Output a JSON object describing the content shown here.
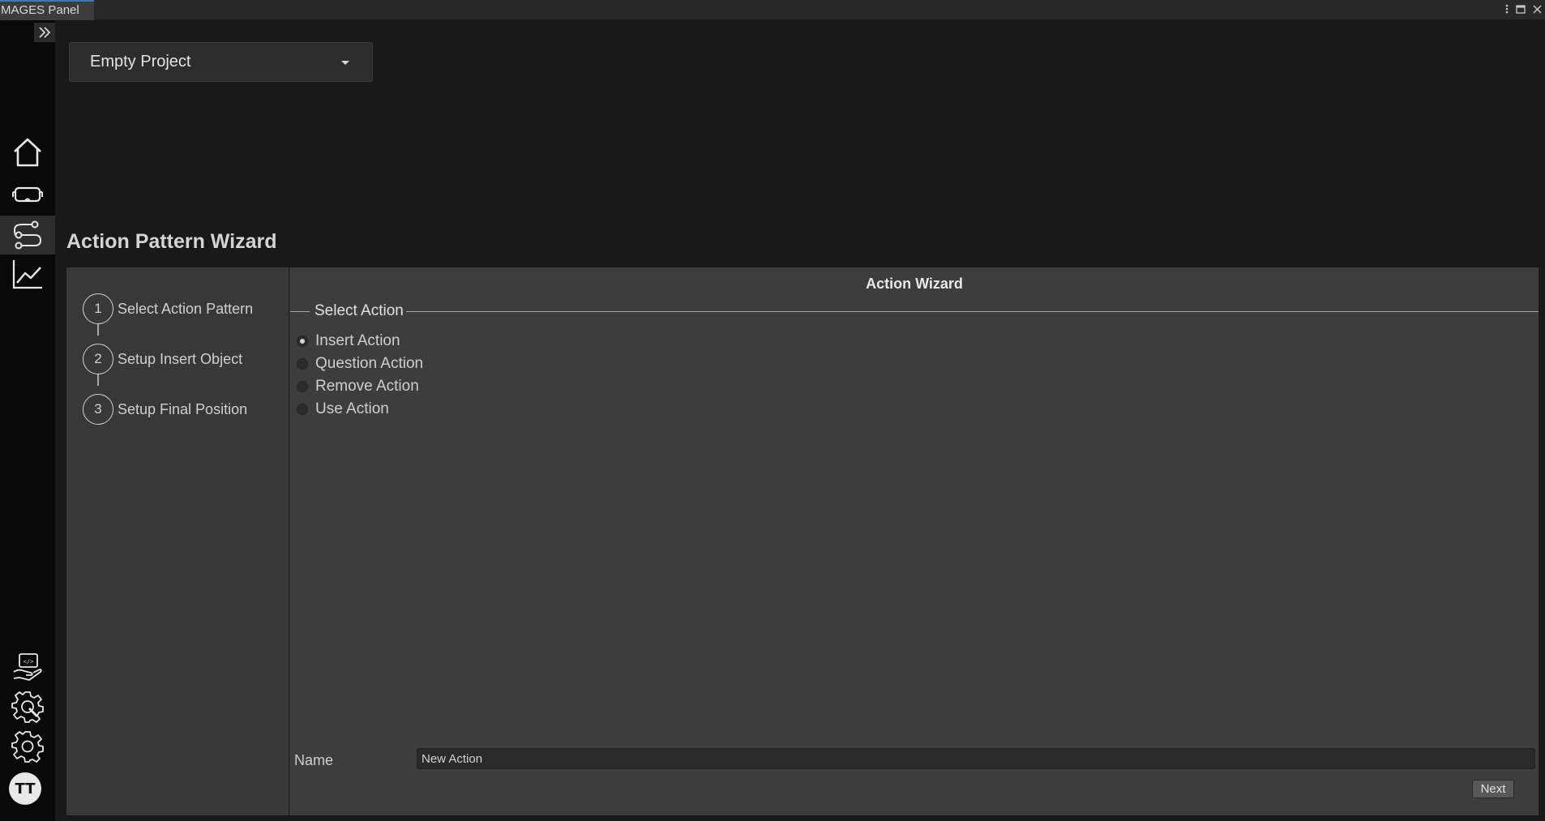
{
  "window": {
    "tab_title": "MAGES Panel",
    "tab_actions": [
      "more-vertical-icon",
      "maximize-icon",
      "close-icon"
    ]
  },
  "sidebar": {
    "expand_icon": "double-chevron-right-icon",
    "items": [
      {
        "name": "home",
        "icon": "home-icon",
        "active": false
      },
      {
        "name": "vr-headset",
        "icon": "vr-headset-icon",
        "active": false
      },
      {
        "name": "action-flow",
        "icon": "flow-icon",
        "active": true
      },
      {
        "name": "analytics",
        "icon": "chart-line-icon",
        "active": false
      }
    ],
    "bottom_items": [
      {
        "name": "developer",
        "icon": "code-hand-icon"
      },
      {
        "name": "tools-settings",
        "icon": "gear-wrench-icon"
      },
      {
        "name": "settings",
        "icon": "gear-icon"
      }
    ],
    "avatar_initials": "TT"
  },
  "project": {
    "selected": "Empty Project"
  },
  "page": {
    "title": "Action Pattern Wizard"
  },
  "steps": [
    {
      "number": "1",
      "label": "Select Action Pattern"
    },
    {
      "number": "2",
      "label": "Setup Insert Object"
    },
    {
      "number": "3",
      "label": "Setup Final Position"
    }
  ],
  "wizard": {
    "title": "Action Wizard",
    "group_legend": "Select Action",
    "options": [
      {
        "label": "Insert Action",
        "checked": true
      },
      {
        "label": "Question Action",
        "checked": false
      },
      {
        "label": "Remove Action",
        "checked": false
      },
      {
        "label": "Use Action",
        "checked": false
      }
    ],
    "name_label": "Name",
    "name_value": "New Action",
    "next_label": "Next"
  },
  "colors": {
    "accent": "#3a79bb",
    "background": "#191919",
    "panel": "#3d3d3d"
  }
}
